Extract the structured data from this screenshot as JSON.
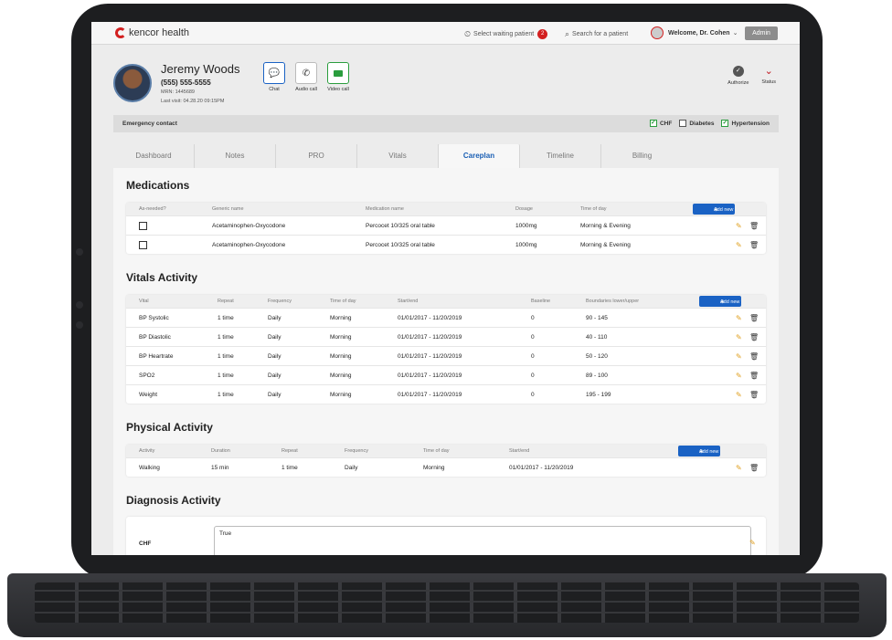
{
  "app": {
    "brand": "kencor health",
    "waiting_label": "Select waiting patient",
    "waiting_count": "2",
    "search_placeholder": "Search for a patient",
    "welcome": "Welcome, Dr. Cohen",
    "admin_label": "Admin"
  },
  "patient": {
    "name": "Jeremy Woods",
    "phone": "(555) 555-5555",
    "mrn": "MRN: 1445689",
    "last_visit": "Last visit: 04.28.20 09:15PM",
    "actions": [
      "Chat",
      "Audio call",
      "Video call"
    ],
    "authorize_label": "Authorize",
    "status_label": "Status"
  },
  "emergency": {
    "label": "Emergency contact",
    "conditions": [
      {
        "label": "CHF",
        "checked": true
      },
      {
        "label": "Diabetes",
        "checked": false
      },
      {
        "label": "Hypertension",
        "checked": true
      }
    ]
  },
  "tabs": [
    "Dashboard",
    "Notes",
    "PRO",
    "Vitals",
    "Careplan",
    "Timeline",
    "Billing"
  ],
  "active_tab": "Careplan",
  "medications": {
    "title": "Medications",
    "add_label": "Add new",
    "headers": [
      "As-needed?",
      "Generic name",
      "Medication name",
      "Dosage",
      "Time of day"
    ],
    "rows": [
      [
        "",
        "Acetaminophen-Oxycodone",
        "Percocet 10/325 oral table",
        "1000mg",
        "Morning & Evening"
      ],
      [
        "",
        "Acetaminophen-Oxycodone",
        "Percocet 10/325 oral table",
        "1000mg",
        "Morning & Evening"
      ]
    ]
  },
  "vitals": {
    "title": "Vitals Activity",
    "add_label": "Add new",
    "headers": [
      "Vital",
      "Repeat",
      "Frequency",
      "Time of day",
      "Start/end",
      "Baseline",
      "Boundaries lower/upper"
    ],
    "rows": [
      [
        "BP Systolic",
        "1 time",
        "Daily",
        "Morning",
        "01/01/2017 - 11/20/2019",
        "0",
        "90 - 145"
      ],
      [
        "BP Diastolic",
        "1 time",
        "Daily",
        "Morning",
        "01/01/2017 - 11/20/2019",
        "0",
        "40 - 110"
      ],
      [
        "BP Heartrate",
        "1 time",
        "Daily",
        "Morning",
        "01/01/2017 - 11/20/2019",
        "0",
        "50 - 120"
      ],
      [
        "SPO2",
        "1 time",
        "Daily",
        "Morning",
        "01/01/2017 - 11/20/2019",
        "0",
        "89 - 100"
      ],
      [
        "Weight",
        "1 time",
        "Daily",
        "Morning",
        "01/01/2017 - 11/20/2019",
        "0",
        "195 - 199"
      ]
    ]
  },
  "physical": {
    "title": "Physical Activity",
    "add_label": "Add new",
    "headers": [
      "Activity",
      "Duration",
      "Repeat",
      "Frequency",
      "Time of day",
      "Start/end"
    ],
    "rows": [
      [
        "Walking",
        "15 min",
        "1 time",
        "Daily",
        "Morning",
        "01/01/2017 - 11/20/2019"
      ]
    ]
  },
  "diagnosis": {
    "title": "Diagnosis Activity",
    "label": "CHF",
    "value": "True"
  }
}
